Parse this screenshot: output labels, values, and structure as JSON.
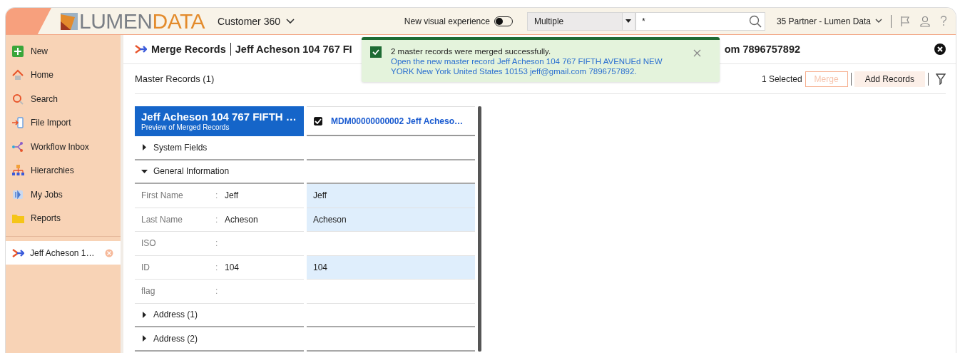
{
  "header": {
    "logo_left": "LUMEN",
    "logo_right": "DATA",
    "app": "Customer 360",
    "toggle": {
      "label": "New visual experience",
      "on": false
    },
    "scope_select": {
      "value": "Multiple"
    },
    "search": {
      "value": "*"
    },
    "org": "35 Partner - Lumen Data"
  },
  "sidebar": {
    "items": [
      {
        "label": "New"
      },
      {
        "label": "Home"
      },
      {
        "label": "Search"
      },
      {
        "label": "File Import"
      },
      {
        "label": "Workflow Inbox"
      },
      {
        "label": "Hierarchies"
      },
      {
        "label": "My Jobs"
      },
      {
        "label": "Reports"
      }
    ],
    "open_tabs": [
      {
        "label": "Jeff Acheson 1…",
        "selected": true
      }
    ]
  },
  "page": {
    "title": "Merge Records",
    "subtitle_start": "Jeff Acheson 104 767 FI",
    "subtitle_end": "om 7896757892"
  },
  "toolbar": {
    "heading": "Master Records (1)",
    "selected_count": "1 Selected",
    "buttons": [
      {
        "label": "Merge",
        "disabled": true
      },
      {
        "label": "Add Records",
        "disabled": false
      }
    ]
  },
  "toast": {
    "message": "2 master records were merged successfully.",
    "link": "Open the new master record Jeff Acheson 104 767 FIFTH AVENUEd NEW YORK New York United States 10153 jeff@gmail.com 7896757892."
  },
  "merge_table": {
    "preview": {
      "title": "Jeff Acheson 104 767 FIFTH …",
      "subtitle": "Preview of Merged Records"
    },
    "record": {
      "label": "MDM00000000002 Jeff Acheso…",
      "checked": true
    },
    "rows": [
      {
        "kind": "section",
        "label": "System Fields",
        "expanded": false
      },
      {
        "kind": "section",
        "label": "General Information",
        "expanded": true
      },
      {
        "kind": "field",
        "label": "First Name",
        "separator": ":",
        "value": "Jeff",
        "record_value": "Jeff",
        "highlighted": true
      },
      {
        "kind": "field",
        "label": "Last Name",
        "separator": ":",
        "value": "Acheson",
        "record_value": "Acheson",
        "highlighted": true
      },
      {
        "kind": "field",
        "label": "ISO",
        "separator": ":",
        "highlighted": false
      },
      {
        "kind": "field",
        "label": "ID",
        "separator": ":",
        "value": "104",
        "record_value": "104",
        "highlighted": true
      },
      {
        "kind": "field",
        "label": "flag",
        "separator": ":",
        "highlighted": false
      },
      {
        "kind": "section",
        "label": "Address (1)",
        "expanded": false
      },
      {
        "kind": "section",
        "label": "Address (2)",
        "expanded": false
      }
    ]
  }
}
